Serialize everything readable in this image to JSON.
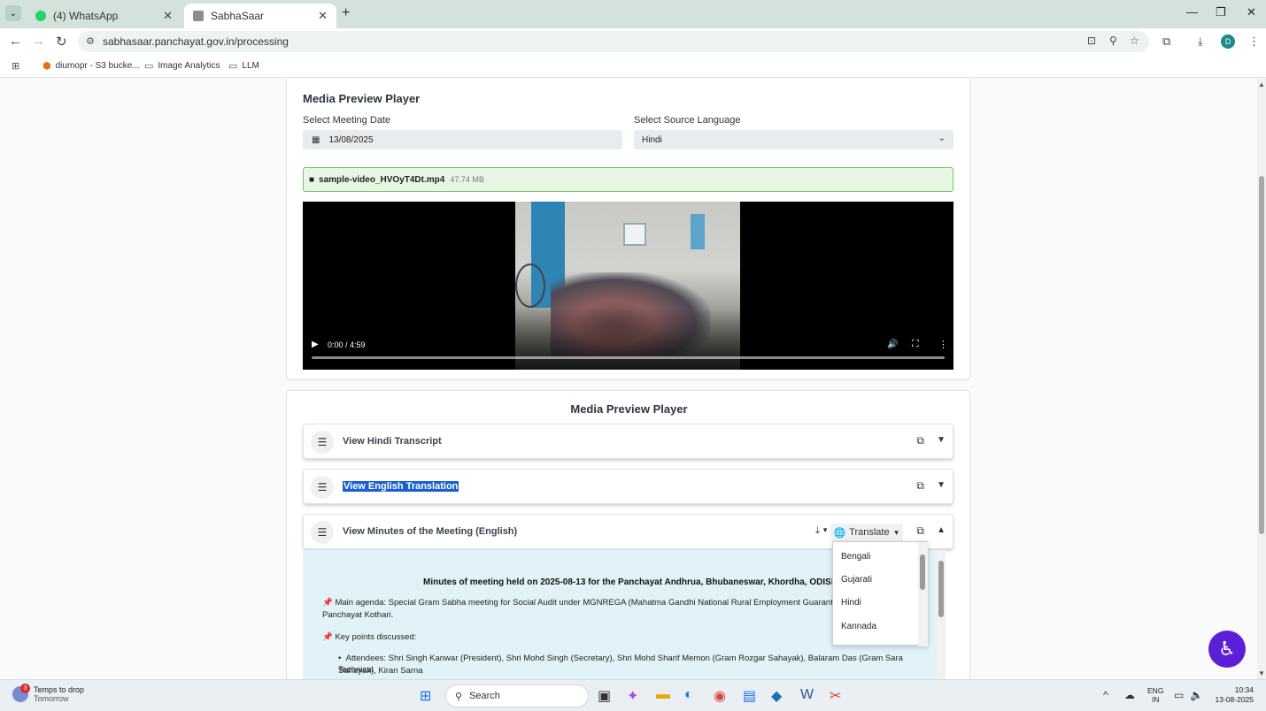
{
  "browser": {
    "tabs": [
      {
        "title": "(4) WhatsApp",
        "active": false
      },
      {
        "title": "SabhaSaar",
        "active": true
      }
    ],
    "url": "sabhasaar.panchayat.gov.in/processing",
    "profile_initial": "D",
    "bookmarks": [
      "diumopr - S3 bucke...",
      "Image Analytics",
      "LLM"
    ]
  },
  "player_card": {
    "title": "Media Preview Player",
    "date_label": "Select Meeting Date",
    "date_value": "13/08/2025",
    "lang_label": "Select Source Language",
    "lang_value": "Hindi",
    "file_name": "sample-video_HVOyT4Dt.mp4",
    "file_size": "47.74 MB",
    "video_time": "0:00 / 4:59"
  },
  "results_card": {
    "title": "Media Preview Player",
    "sections": [
      {
        "label": "View Hindi Transcript"
      },
      {
        "label": "View English Translation"
      },
      {
        "label": "View Minutes of the Meeting (English)"
      }
    ],
    "translate_label": "Translate",
    "minutes": {
      "heading": "Minutes of meeting held on 2025-08-13 for the Panchayat Andhrua, Bhubaneswar, Khordha, ODISHA",
      "agenda": "Main agenda: Special Gram Sabha meeting for Social Audit under MGNREGA (Mahatma Gandhi National Rural Employment Guarante",
      "agenda_cont": "Panchayat Kothari.",
      "key_points": "Key points discussed:",
      "attendees": "Attendees: Shri Singh Kanwar (President), Shri Mohd Singh (Secretary), Shri Mohd Sharif Memon (Gram Rozgar Sahayak), Balaram Das (Gram Sara Technical",
      "attendees_cont": "Sahayak), Kiran Sarna"
    },
    "translate_options": [
      "Bengali",
      "Gujarati",
      "Hindi",
      "Kannada"
    ]
  },
  "taskbar": {
    "weather_title": "Temps to drop",
    "weather_sub": "Tomorrow",
    "weather_badge": "3",
    "search_placeholder": "Search",
    "lang_1": "ENG",
    "lang_2": "IN",
    "time": "10:34",
    "date": "13-08-2025"
  }
}
